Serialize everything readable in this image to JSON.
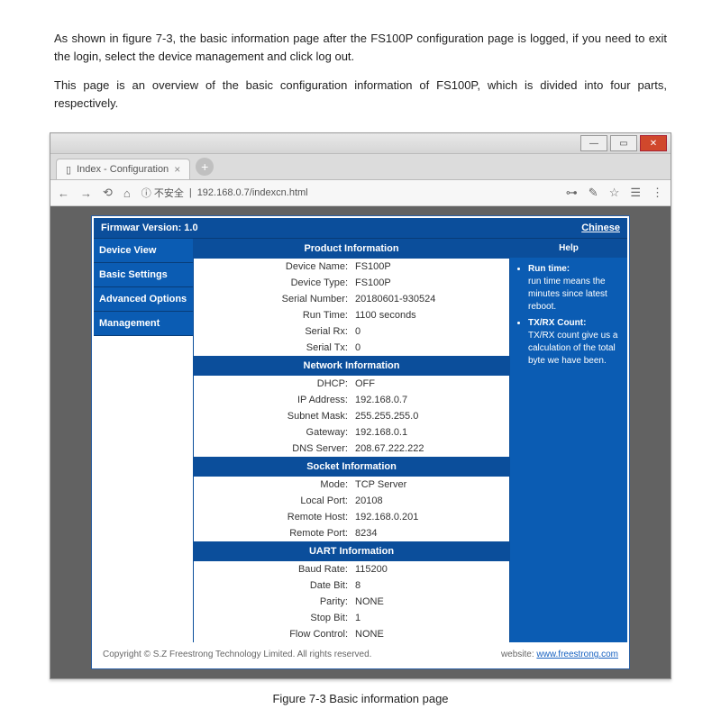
{
  "doc": {
    "para1": "As shown in figure 7-3, the basic information page after the FS100P configuration page is logged, if you need to exit the login, select the device management and click log out.",
    "para2": "This page is an overview of the basic configuration information of FS100P, which is divided into four parts, respectively.",
    "caption": "Figure 7-3 Basic information page"
  },
  "browser": {
    "tab_title": "Index - Configuration",
    "tab_close": "×",
    "new_tab": "+",
    "nav_back": "←",
    "nav_fwd": "→",
    "nav_reload": "⟲",
    "nav_home": "⌂",
    "secure_info": "ⓘ 不安全",
    "url": "192.168.0.7/indexcn.html",
    "key_icon": "⊶",
    "cfg_icon": "✎",
    "star_icon": "☆",
    "user_icon": "☰",
    "menu_icon": "⋮",
    "win_min": "—",
    "win_max": "▭",
    "win_close": "✕"
  },
  "top": {
    "firmware_label": "Firmwar Version: 1.0",
    "lang_link": "Chinese"
  },
  "sidebar": {
    "items": [
      "Device View",
      "Basic Settings",
      "Advanced Options",
      "Management"
    ]
  },
  "sections": {
    "product": {
      "title": "Product Information",
      "rows": [
        {
          "k": "Device Name:",
          "v": "FS100P"
        },
        {
          "k": "Device Type:",
          "v": "FS100P"
        },
        {
          "k": "Serial Number:",
          "v": "20180601-930524"
        },
        {
          "k": "Run Time:",
          "v": "1100 seconds"
        },
        {
          "k": "Serial Rx:",
          "v": "0"
        },
        {
          "k": "Serial Tx:",
          "v": "0"
        }
      ]
    },
    "network": {
      "title": "Network Information",
      "rows": [
        {
          "k": "DHCP:",
          "v": "OFF"
        },
        {
          "k": "IP Address:",
          "v": "192.168.0.7"
        },
        {
          "k": "Subnet Mask:",
          "v": "255.255.255.0"
        },
        {
          "k": "Gateway:",
          "v": "192.168.0.1"
        },
        {
          "k": "DNS Server:",
          "v": "208.67.222.222"
        }
      ]
    },
    "socket": {
      "title": "Socket Information",
      "rows": [
        {
          "k": "Mode:",
          "v": "TCP Server"
        },
        {
          "k": "Local Port:",
          "v": "20108"
        },
        {
          "k": "Remote Host:",
          "v": "192.168.0.201"
        },
        {
          "k": "Remote Port:",
          "v": "8234"
        }
      ]
    },
    "uart": {
      "title": "UART Information",
      "rows": [
        {
          "k": "Baud Rate:",
          "v": "115200"
        },
        {
          "k": "Date Bit:",
          "v": "8"
        },
        {
          "k": "Parity:",
          "v": "NONE"
        },
        {
          "k": "Stop Bit:",
          "v": "1"
        },
        {
          "k": "Flow Control:",
          "v": "NONE"
        }
      ]
    }
  },
  "help": {
    "title": "Help",
    "items": [
      {
        "h": "Run time:",
        "t": "run time means the minutes since latest reboot."
      },
      {
        "h": "TX/RX Count:",
        "t": "TX/RX count give us a calculation of the total byte we have been."
      }
    ]
  },
  "footer": {
    "copyright": "Copyright © S.Z Freestrong Technology Limited. All rights reserved.",
    "site_label": "website:",
    "site_link": "www.freestrong.com"
  }
}
